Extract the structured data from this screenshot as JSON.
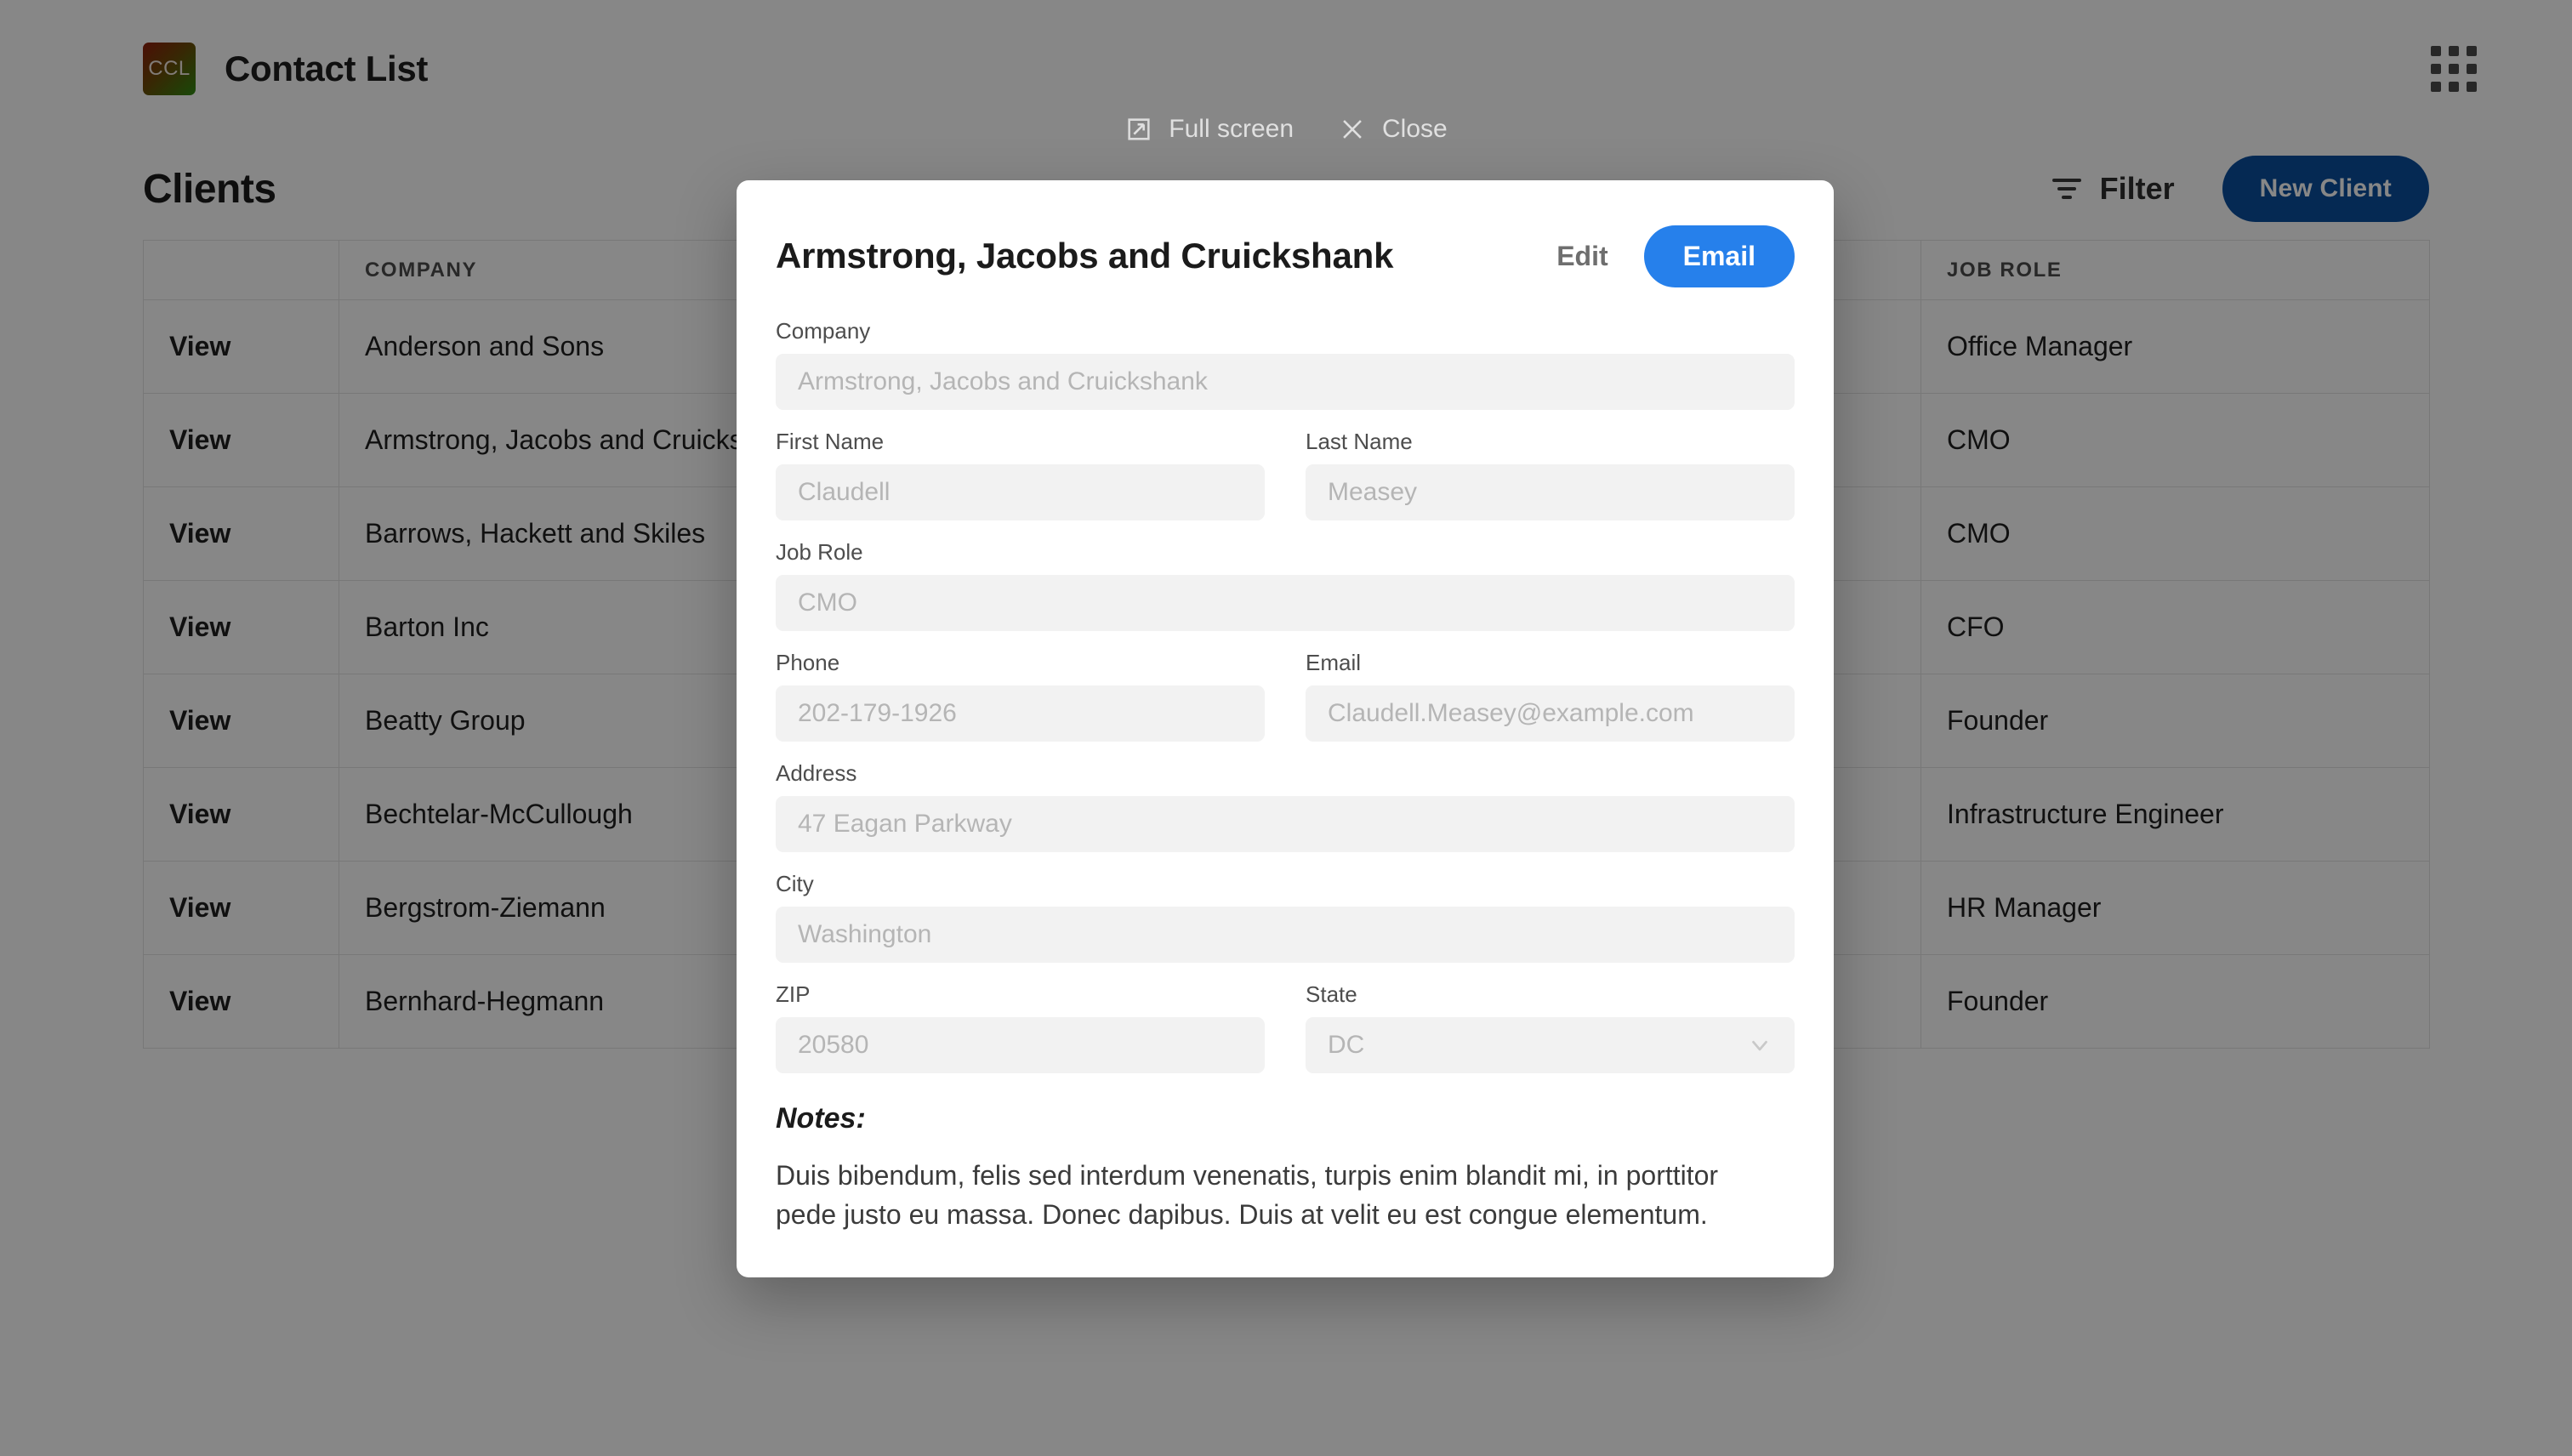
{
  "header": {
    "logo_text": "CCL",
    "app_title": "Contact List",
    "apps_grid_icon": "grid-icon"
  },
  "overlay_tools": {
    "fullscreen_label": "Full screen",
    "fullscreen_icon": "expand-icon",
    "close_label": "Close",
    "close_icon": "close-icon"
  },
  "page": {
    "title": "Clients",
    "filter_label": "Filter",
    "filter_icon": "funnel-icon",
    "new_client_label": "New Client"
  },
  "table": {
    "columns": [
      "",
      "COMPANY",
      "JOB ROLE"
    ],
    "view_label": "View",
    "rows": [
      {
        "company": "Anderson and Sons",
        "role": "Office Manager"
      },
      {
        "company": "Armstrong, Jacobs and Cruicks…",
        "role": "CMO"
      },
      {
        "company": "Barrows, Hackett and Skiles",
        "role": "CMO"
      },
      {
        "company": "Barton Inc",
        "role": "CFO"
      },
      {
        "company": "Beatty Group",
        "role": "Founder"
      },
      {
        "company": "Bechtelar-McCullough",
        "role": "Infrastructure Engineer"
      },
      {
        "company": "Bergstrom-Ziemann",
        "role": "HR Manager"
      },
      {
        "company": "Bernhard-Hegmann",
        "role": "Founder"
      }
    ]
  },
  "modal": {
    "title": "Armstrong, Jacobs and Cruickshank",
    "edit_label": "Edit",
    "email_label": "Email",
    "fields": {
      "company_label": "Company",
      "company_value": "Armstrong, Jacobs and Cruickshank",
      "first_name_label": "First Name",
      "first_name_value": "Claudell",
      "last_name_label": "Last Name",
      "last_name_value": "Measey",
      "job_role_label": "Job Role",
      "job_role_value": "CMO",
      "phone_label": "Phone",
      "phone_value": "202-179-1926",
      "email_label": "Email",
      "email_value": "Claudell.Measey@example.com",
      "address_label": "Address",
      "address_value": "47 Eagan Parkway",
      "city_label": "City",
      "city_value": "Washington",
      "zip_label": "ZIP",
      "zip_value": "20580",
      "state_label": "State",
      "state_value": "DC",
      "state_chevron_icon": "chevron-down-icon"
    },
    "notes_heading": "Notes:",
    "notes_text": "Duis bibendum, felis sed interdum venenatis, turpis enim blandit mi, in porttitor pede justo eu massa. Donec dapibus. Duis at velit eu est congue elementum."
  },
  "colors": {
    "email_button": "#2680eb",
    "new_client_button": "#0b4f9e",
    "logo_gradient_start": "#8f1d0d",
    "logo_gradient_end": "#2f8a12",
    "field_background": "#f2f2f2"
  }
}
